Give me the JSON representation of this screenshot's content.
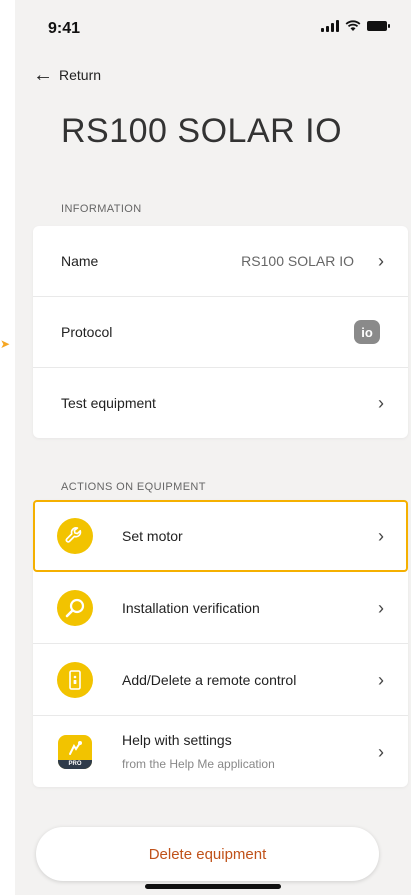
{
  "status": {
    "time": "9:41"
  },
  "nav": {
    "back_label": "Return"
  },
  "page_title": "RS100 SOLAR IO",
  "information": {
    "section_label": "INFORMATION",
    "rows": [
      {
        "label": "Name",
        "value": "RS100 SOLAR IO"
      },
      {
        "label": "Protocol",
        "badge": "io"
      },
      {
        "label": "Test equipment"
      }
    ]
  },
  "actions": {
    "section_label": "ACTIONS ON EQUIPMENT",
    "rows": [
      {
        "label": "Set motor",
        "icon": "wrench-icon"
      },
      {
        "label": "Installation verification",
        "icon": "magnifier-icon"
      },
      {
        "label": "Add/Delete a remote control",
        "icon": "remote-control-icon"
      },
      {
        "label": "Help with settings",
        "sublabel": "from the Help Me application",
        "icon": "help-me-pro-icon",
        "badge": "PRO"
      }
    ]
  },
  "delete_button": "Delete equipment",
  "colors": {
    "accent": "#f2c300",
    "highlight": "#f5b000",
    "danger": "#c0521a"
  }
}
